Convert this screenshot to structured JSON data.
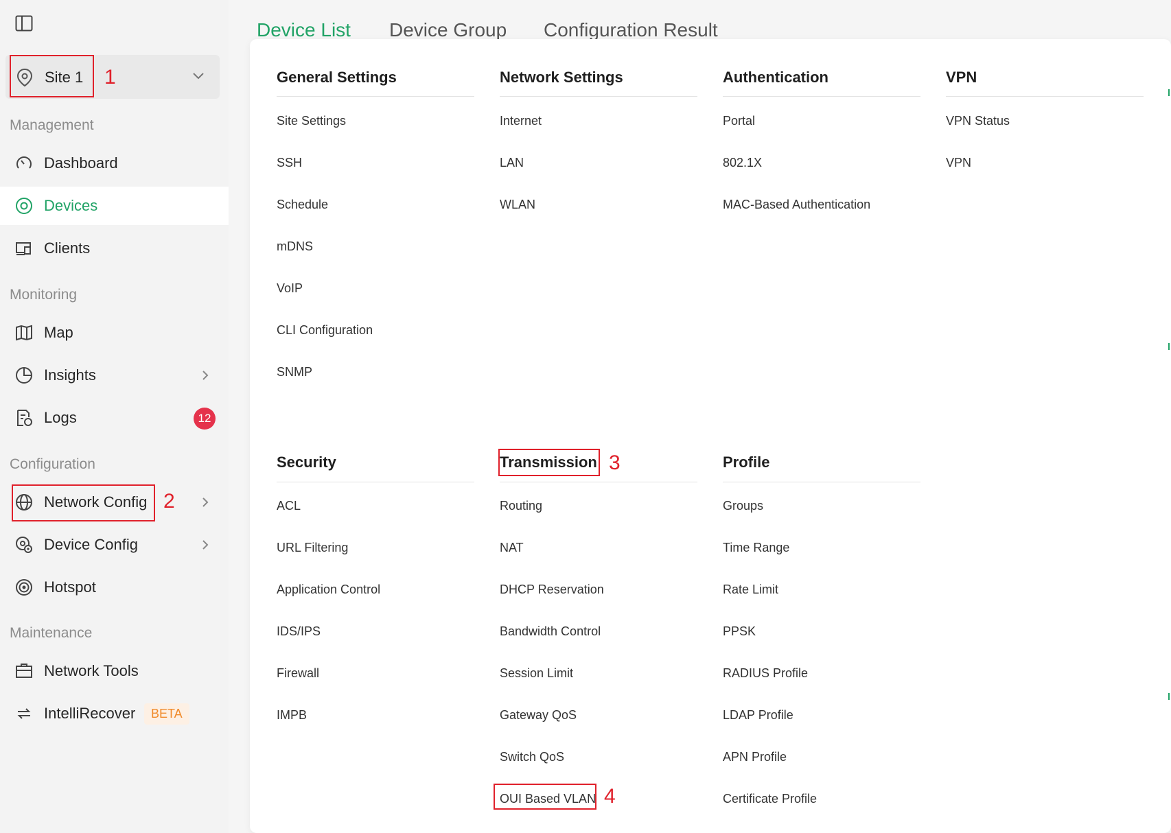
{
  "site": {
    "label": "Site 1"
  },
  "sidebar": {
    "sections": {
      "management": "Management",
      "monitoring": "Monitoring",
      "configuration": "Configuration",
      "maintenance": "Maintenance"
    },
    "items": {
      "dashboard": "Dashboard",
      "devices": "Devices",
      "clients": "Clients",
      "map": "Map",
      "insights": "Insights",
      "logs": "Logs",
      "network_config": "Network Config",
      "device_config": "Device Config",
      "hotspot": "Hotspot",
      "network_tools": "Network Tools",
      "intellirecover": "IntelliRecover"
    },
    "logs_badge": "12",
    "beta_label": "BETA",
    "active_item": "Devices"
  },
  "tabs": [
    "Device List",
    "Device Group",
    "Configuration Result"
  ],
  "menu": {
    "general": {
      "title": "General Settings",
      "items": [
        "Site Settings",
        "SSH",
        "Schedule",
        "mDNS",
        "VoIP",
        "CLI Configuration",
        "SNMP"
      ]
    },
    "network": {
      "title": "Network Settings",
      "items": [
        "Internet",
        "LAN",
        "WLAN"
      ]
    },
    "auth": {
      "title": "Authentication",
      "items": [
        "Portal",
        "802.1X",
        "MAC-Based Authentication"
      ]
    },
    "vpn": {
      "title": "VPN",
      "items": [
        "VPN Status",
        "VPN"
      ]
    },
    "security": {
      "title": "Security",
      "items": [
        "ACL",
        "URL Filtering",
        "Application Control",
        "IDS/IPS",
        "Firewall",
        "IMPB"
      ]
    },
    "transmission": {
      "title": "Transmission",
      "items": [
        "Routing",
        "NAT",
        "DHCP Reservation",
        "Bandwidth Control",
        "Session Limit",
        "Gateway QoS",
        "Switch QoS",
        "OUI Based VLAN"
      ]
    },
    "profile": {
      "title": "Profile",
      "items": [
        "Groups",
        "Time Range",
        "Rate Limit",
        "PPSK",
        "RADIUS Profile",
        "LDAP Profile",
        "APN Profile",
        "Certificate Profile"
      ]
    }
  },
  "annotations": [
    "1",
    "2",
    "3",
    "4"
  ],
  "colors": {
    "accent": "#21a366",
    "annotation": "#e0212b",
    "badge": "#e5324b"
  }
}
